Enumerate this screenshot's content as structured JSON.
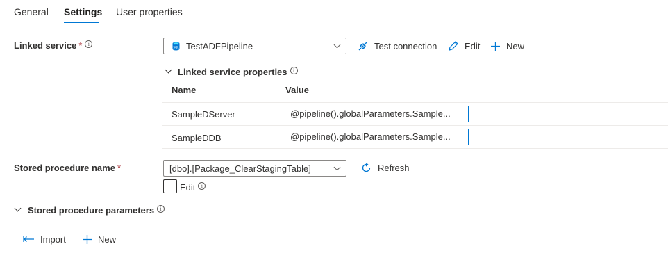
{
  "tabs": [
    {
      "label": "General"
    },
    {
      "label": "Settings"
    },
    {
      "label": "User properties"
    }
  ],
  "linked_service": {
    "label": "Linked service",
    "required_mark": "*",
    "info": "i",
    "selected": "TestADFPipeline",
    "actions": {
      "test_connection": "Test connection",
      "edit": "Edit",
      "new": "New"
    }
  },
  "linked_service_properties": {
    "title": "Linked service properties",
    "info": "i",
    "columns": [
      "Name",
      "Value"
    ],
    "rows": [
      {
        "name": "SampleDServer",
        "value": "@pipeline().globalParameters.Sample..."
      },
      {
        "name": "SampleDDB",
        "value": "@pipeline().globalParameters.Sample..."
      }
    ]
  },
  "stored_procedure": {
    "label": "Stored procedure name",
    "required_mark": "*",
    "selected": "[dbo].[Package_ClearStagingTable]",
    "refresh": "Refresh",
    "edit_label": "Edit",
    "edit_info": "i",
    "edit_checked": false
  },
  "stored_procedure_parameters": {
    "title": "Stored procedure parameters",
    "info": "i",
    "actions": {
      "import": "Import",
      "new": "New"
    }
  },
  "colors": {
    "accent": "#0078d4",
    "border": "#8a8886",
    "text": "#323130",
    "required": "#a4262c"
  }
}
